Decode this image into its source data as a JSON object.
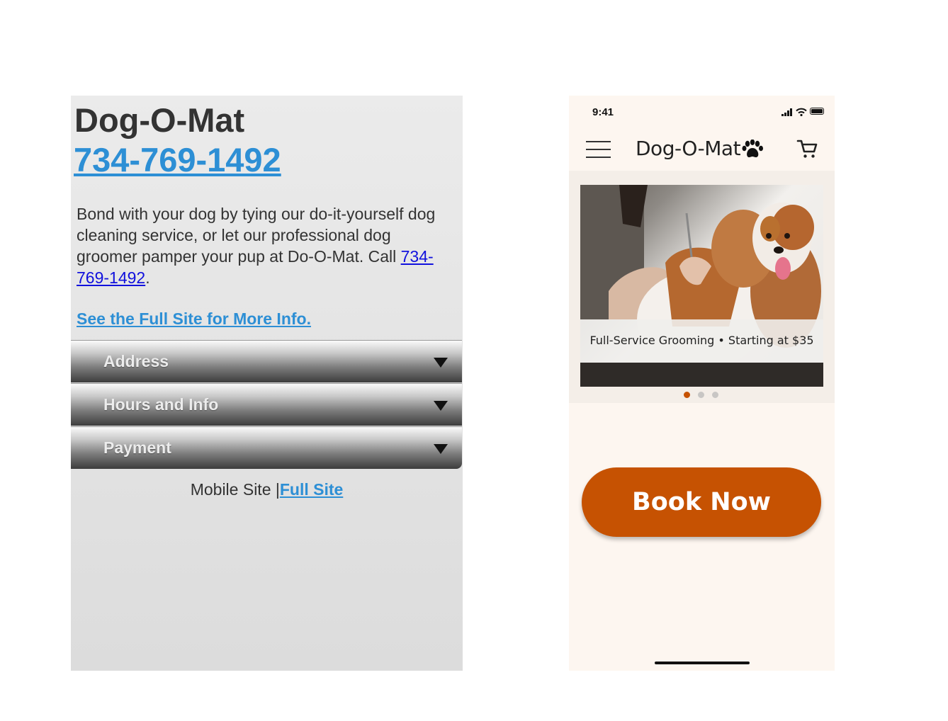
{
  "old_site": {
    "brand": "Dog-O-Mat",
    "phone": "734-769-1492",
    "intro_text": "Bond with your dog by tying our do-it-yourself dog cleaning service, or let our professional dog groomer pamper your pup at Do-O-Mat. Call ",
    "intro_phone": "734-769-1492",
    "intro_end": ".",
    "full_info_link": "See the Full Site for More Info.",
    "accordion": [
      "Address",
      "Hours and Info",
      "Payment"
    ],
    "footer_text": "Mobile Site |",
    "footer_link": "Full Site"
  },
  "new_app": {
    "status_time": "9:41",
    "title": "Dog-O-Mat",
    "icons": {
      "menu": "hamburger-menu-icon",
      "logo": "paw-icon",
      "cart": "cart-icon",
      "status": [
        "signal-icon",
        "wifi-icon",
        "battery-icon"
      ]
    },
    "hero_caption": "Full-Service Grooming  •  Starting at $35",
    "carousel_total": 3,
    "carousel_active": 1,
    "book_button": "Book Now"
  },
  "colors": {
    "link_blue": "#2d8fd5",
    "accent_orange": "#c65202",
    "app_background": "#fdf6f0",
    "old_site_background": "#e6e6e6"
  }
}
